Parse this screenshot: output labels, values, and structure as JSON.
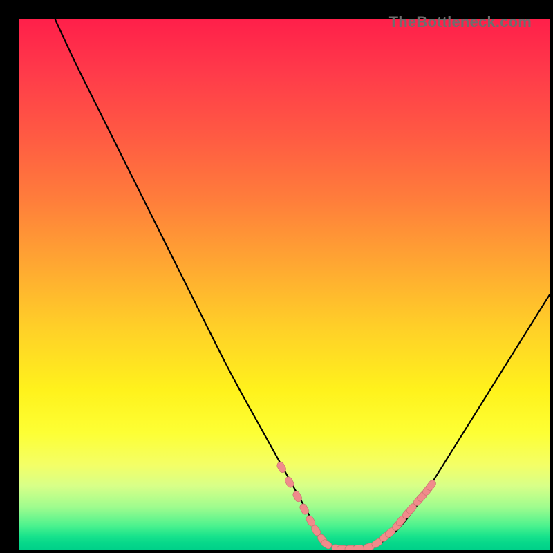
{
  "watermark": "TheBottleneck.com",
  "colors": {
    "gradient_top": "#ff1f4a",
    "gradient_mid": "#ffd326",
    "gradient_bottom": "#00d189",
    "curve": "#000000",
    "marker": "#f08b8b",
    "marker_stroke": "#c46e6e"
  },
  "chart_data": {
    "type": "line",
    "title": "",
    "xlabel": "",
    "ylabel": "",
    "xlim": [
      0,
      100
    ],
    "ylim": [
      0,
      100
    ],
    "grid": false,
    "legend": false,
    "series": [
      {
        "name": "bottleneck-curve",
        "x": [
          0,
          5,
          10,
          15,
          20,
          25,
          30,
          35,
          40,
          45,
          50,
          55,
          57,
          60,
          62,
          65,
          70,
          75,
          80,
          85,
          90,
          95,
          100
        ],
        "y": [
          115,
          104,
          93,
          83,
          73,
          63,
          53,
          43,
          33,
          24,
          15,
          6,
          2,
          0,
          0,
          0,
          2,
          8,
          16,
          24,
          32,
          40,
          48
        ]
      }
    ],
    "markers": {
      "name": "highlighted-points",
      "x": [
        49.5,
        51.0,
        52.5,
        53.8,
        55.0,
        56.0,
        57.2,
        58.0,
        60.0,
        61.0,
        62.5,
        64.0,
        66.0,
        67.5,
        69.0,
        70.0,
        71.3,
        72.0,
        73.2,
        74.0,
        75.3,
        76.0,
        77.0,
        77.7
      ],
      "y": [
        15.5,
        12.7,
        10.0,
        7.6,
        5.4,
        3.6,
        1.9,
        1.0,
        0.2,
        0.1,
        0.1,
        0.2,
        0.5,
        1.2,
        2.4,
        3.2,
        4.5,
        5.4,
        6.8,
        7.7,
        9.2,
        10.0,
        11.2,
        12.1
      ]
    }
  }
}
